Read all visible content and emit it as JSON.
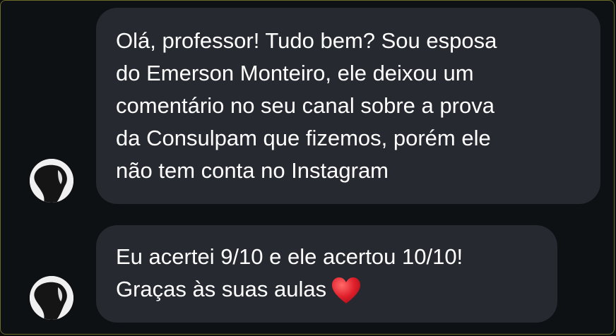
{
  "messages": [
    {
      "lines": [
        "Olá, professor! Tudo bem? Sou esposa",
        "do Emerson Monteiro, ele deixou um",
        "comentário no seu canal sobre a prova",
        "da Consulpam que fizemos, porém ele",
        "não tem conta no Instagram"
      ],
      "avatar": "user-avatar"
    },
    {
      "lines": [
        "Eu acertei 9/10 e ele acertou 10/10!",
        "Graças às suas aulas"
      ],
      "emoji": "red-heart-icon",
      "avatar": "user-avatar"
    }
  ],
  "colors": {
    "background": "#0e1114",
    "bubble": "#262a30",
    "text": "#ffffff",
    "heart": "#e0202b",
    "border": "#6b6b2a"
  }
}
